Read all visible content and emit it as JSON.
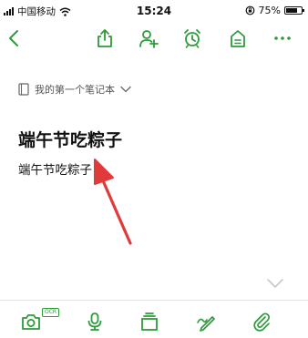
{
  "status_bar": {
    "carrier": "中国移动",
    "time": "15:24",
    "battery_percent": "75%",
    "battery_level": 0.75,
    "icons": [
      "signal-icon",
      "wifi-icon",
      "rotation-lock-icon",
      "battery-icon"
    ]
  },
  "toolbar": {
    "icons": [
      "back-icon",
      "share-icon",
      "add-collaborator-icon",
      "reminder-alarm-icon",
      "save-to-home-icon",
      "more-icon"
    ]
  },
  "notebook": {
    "name": "我的第一个笔记本",
    "icons": [
      "notebook-icon",
      "chevron-down-icon"
    ]
  },
  "note": {
    "title": "端午节吃粽子",
    "body": "端午节吃粽子"
  },
  "bottom_bar": {
    "ocr_badge": "OCR",
    "icons": [
      "camera-ocr-icon",
      "voice-record-icon",
      "insert-card-icon",
      "handwriting-icon",
      "attachment-icon"
    ]
  },
  "colors": {
    "accent": "#2d9b3a",
    "annotation_arrow": "#e03a3a",
    "text": "#111111",
    "muted": "#555555"
  }
}
